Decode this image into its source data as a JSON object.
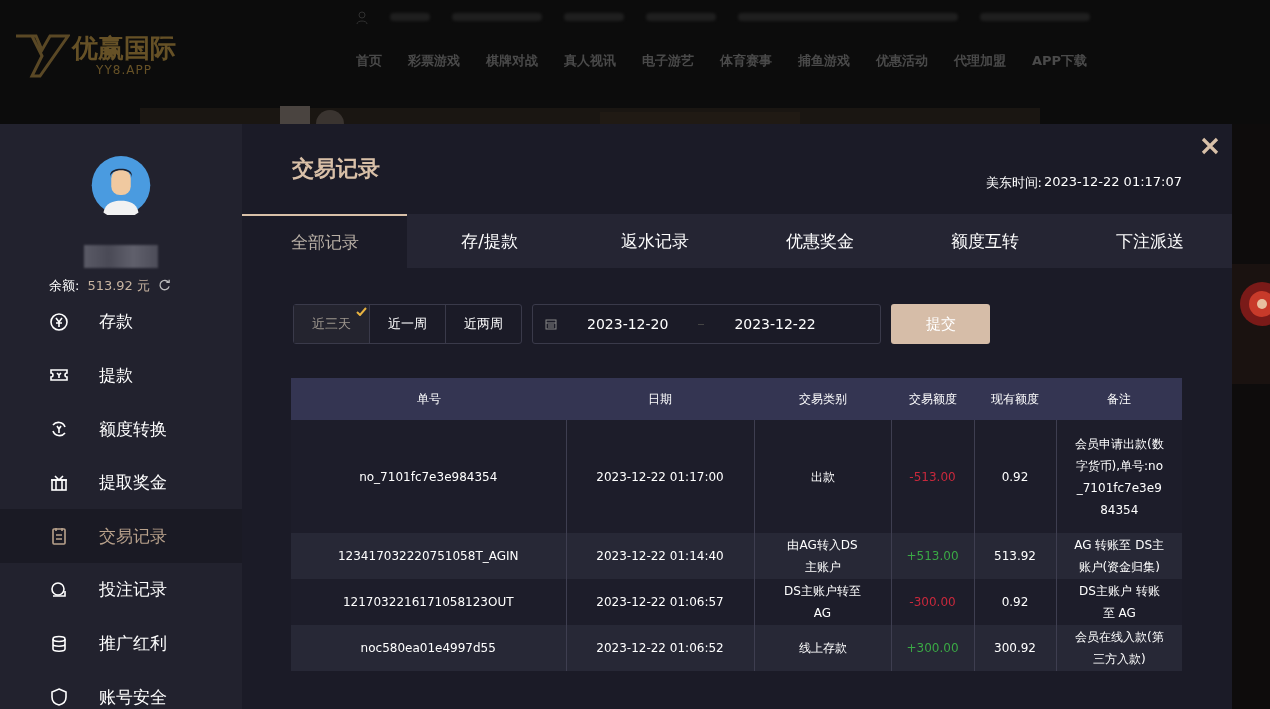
{
  "site_header": {
    "logo": {
      "name": "优赢国际",
      "domain": "YY8.APP"
    },
    "nav": [
      "首页",
      "彩票游戏",
      "棋牌对战",
      "真人视讯",
      "电子游艺",
      "体育赛事",
      "捕鱼游戏",
      "优惠活动",
      "代理加盟",
      "APP下载"
    ]
  },
  "sidebar": {
    "balance_label": "余额:",
    "balance": "513.92 元",
    "items": [
      {
        "label": "存款",
        "selected": false
      },
      {
        "label": "提款",
        "selected": false
      },
      {
        "label": "额度转换",
        "selected": false
      },
      {
        "label": "提取奖金",
        "selected": false
      },
      {
        "label": "交易记录",
        "selected": true
      },
      {
        "label": "投注记录",
        "selected": false
      },
      {
        "label": "推广红利",
        "selected": false
      },
      {
        "label": "账号安全",
        "selected": false
      }
    ]
  },
  "panel": {
    "title": "交易记录",
    "time_label": "美东时间:",
    "time": "2023-12-22 01:17:07",
    "tabs": [
      {
        "label": "全部记录",
        "selected": true
      },
      {
        "label": "存/提款",
        "selected": false
      },
      {
        "label": "返水记录",
        "selected": false
      },
      {
        "label": "优惠奖金",
        "selected": false
      },
      {
        "label": "额度互转",
        "selected": false
      },
      {
        "label": "下注派送",
        "selected": false
      }
    ],
    "periods": [
      {
        "label": "近三天",
        "selected": true
      },
      {
        "label": "近一周",
        "selected": false
      },
      {
        "label": "近两周",
        "selected": false
      }
    ],
    "date_from": "2023-12-20",
    "date_to": "2023-12-22",
    "submit": "提交",
    "table": {
      "columns": [
        "单号",
        "日期",
        "交易类别",
        "交易额度",
        "现有额度",
        "备注"
      ],
      "rows": [
        {
          "id": "no_7101fc7e3e984354",
          "date": "2023-12-22 01:17:00",
          "type": "出款",
          "amount": "-513.00",
          "color": "#c8283c",
          "balance": "0.92",
          "note": "会员申请出款(数字货币),单号:no_7101fc7e3e984354"
        },
        {
          "id": "123417032220751058T_AGIN",
          "date": "2023-12-22 01:14:40",
          "type": "由AG转入DS主账户",
          "amount": "+513.00",
          "color": "#3aa845",
          "balance": "513.92",
          "note": "AG 转账至 DS主账户(资金归集)"
        },
        {
          "id": "1217032216171058123OUT",
          "date": "2023-12-22 01:06:57",
          "type": "DS主账户转至AG",
          "amount": "-300.00",
          "color": "#c8283c",
          "balance": "0.92",
          "note": "DS主账户 转账至 AG"
        },
        {
          "id": "noc580ea01e4997d55",
          "date": "2023-12-22 01:06:52",
          "type": "线上存款",
          "amount": "+300.00",
          "color": "#3aa845",
          "balance": "300.92",
          "note": "会员在线入款(第三方入款)"
        }
      ]
    }
  }
}
